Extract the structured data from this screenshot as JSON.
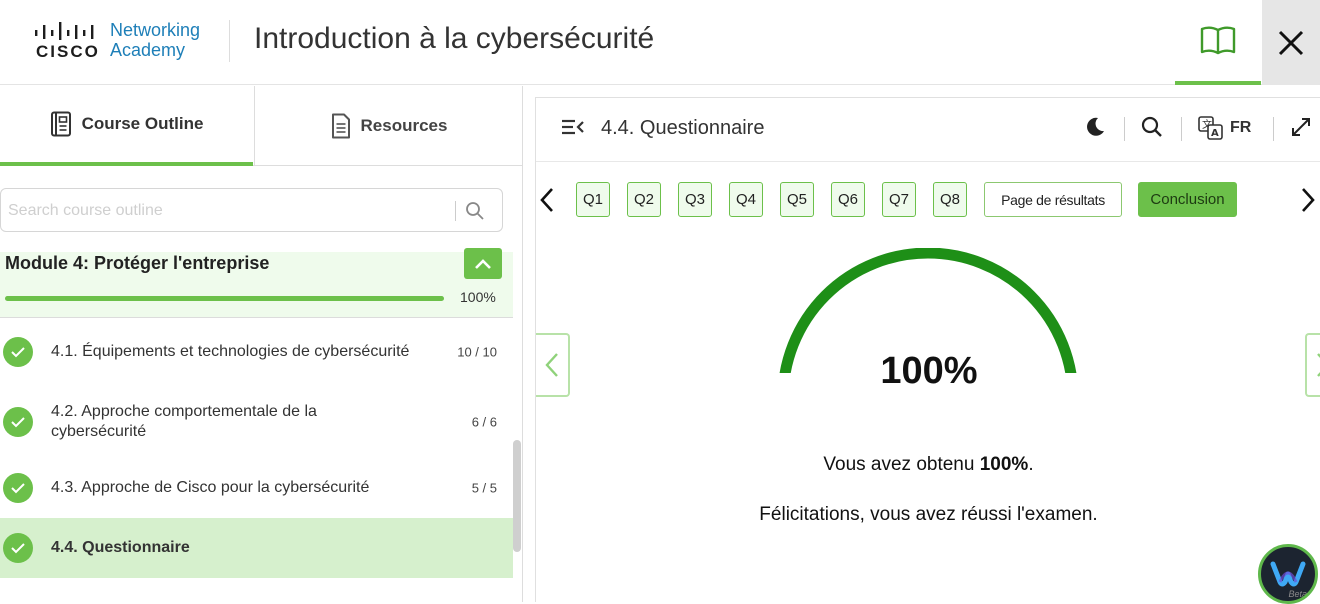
{
  "header": {
    "logo_brand": "CISCO",
    "logo_line1": "Networking",
    "logo_line2": "Academy",
    "course_title": "Introduction à la cybersécurité",
    "book_icon": "book-open-icon",
    "close_icon": "close-icon"
  },
  "sidebar": {
    "tabs": [
      {
        "label": "Course Outline",
        "icon": "outline-icon",
        "active": true
      },
      {
        "label": "Resources",
        "icon": "document-icon",
        "active": false
      }
    ],
    "search_placeholder": "Search course outline",
    "module": {
      "title": "Module 4: Protéger l'entreprise",
      "progress_pct": 100,
      "progress_label": "100%"
    },
    "lessons": [
      {
        "label": "4.1. Équipements et technologies de cybersécurité",
        "count": "10 / 10",
        "done": true
      },
      {
        "label": "4.2. Approche comportementale de la cybersécurité",
        "count": "6 / 6",
        "done": true
      },
      {
        "label": "4.3. Approche de Cisco pour la cybersécurité",
        "count": "5 / 5",
        "done": true
      },
      {
        "label": "4.4. Questionnaire",
        "count": "",
        "done": true,
        "active": true
      }
    ]
  },
  "main": {
    "page_title": "4.4. Questionnaire",
    "language": "FR",
    "questions": [
      "Q1",
      "Q2",
      "Q3",
      "Q4",
      "Q5",
      "Q6",
      "Q7",
      "Q8"
    ],
    "results_label": "Page de résultats",
    "conclusion_label": "Conclusion",
    "score_label": "100%",
    "score_pct": 100,
    "message_prefix": "Vous avez obtenu ",
    "message_score": "100%",
    "message_suffix": ".",
    "congrats": "Félicitations, vous avez réussi l'examen."
  },
  "badge": {
    "label": "Beta"
  },
  "colors": {
    "accent": "#6cc04a",
    "gauge": "#1e8f17",
    "brand_blue": "#1e7fb8"
  }
}
